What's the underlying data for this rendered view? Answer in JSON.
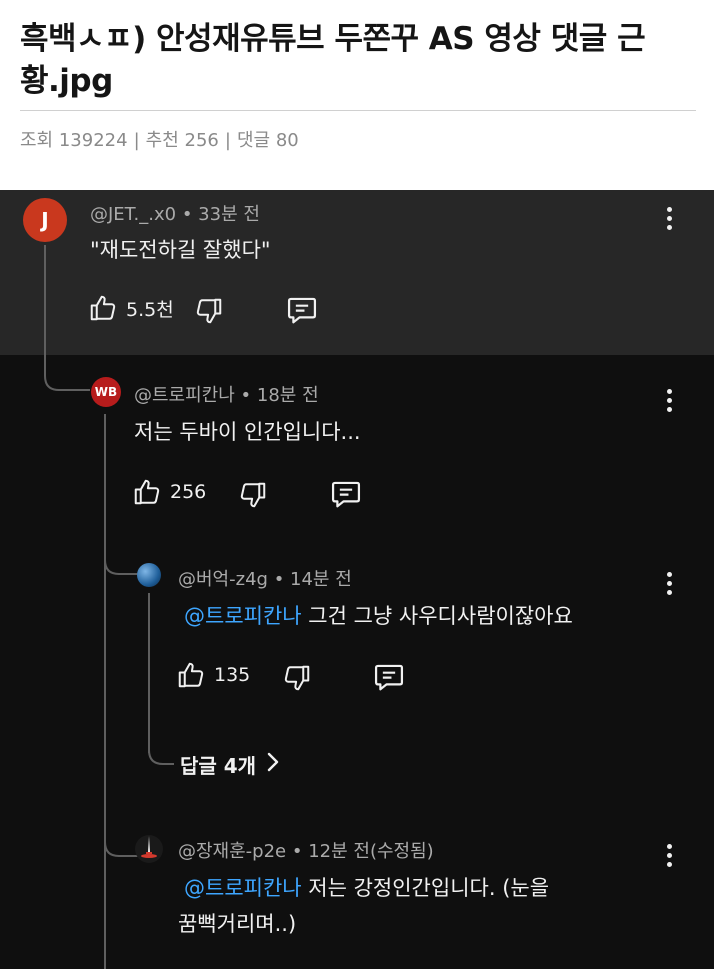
{
  "post": {
    "title": "흑백ㅅㅍ) 안성재유튜브 두쫀꾸 AS 영상 댓글 근황.jpg",
    "views_label": "조회",
    "views": "139224",
    "recommend_label": "추천",
    "recommend": "256",
    "comments_label": "댓글",
    "comments": "80",
    "separator": "|"
  },
  "comments": [
    {
      "avatar_text": "J",
      "avatar_color": "#c9381e",
      "author": "@JET._.x0",
      "time": "• 33분 전",
      "text": "\"재도전하길 잘했다\"",
      "likes": "5.5천"
    },
    {
      "avatar_text": "WB",
      "avatar_color": "#b71c1c",
      "author": "@트로피칸나",
      "time": "• 18분 전",
      "text": "저는 두바이 인간입니다...",
      "likes": "256"
    },
    {
      "avatar_text": "",
      "avatar_color": "#1f5f9a",
      "author": "@버억-z4g",
      "time": "• 14분 전",
      "mention": "@트로피칸나",
      "text": " 그건 그냥 사우디사람이잖아요",
      "likes": "135"
    },
    {
      "avatar_text": "",
      "avatar_color": "#1a1a1a",
      "author": "@장재훈-p2e",
      "time": "• 12분 전(수정됨)",
      "mention": "@트로피칸나",
      "text_line1": " 저는 강정인간입니다. (눈을",
      "text_line2": "꿈뻑거리며..)"
    }
  ],
  "more_replies": "답글 4개",
  "icons": {
    "like": "thumbs-up-icon",
    "dislike": "thumbs-down-icon",
    "reply": "reply-comment-icon",
    "menu": "kebab-menu-icon",
    "chevron": "chevron-right-icon"
  }
}
